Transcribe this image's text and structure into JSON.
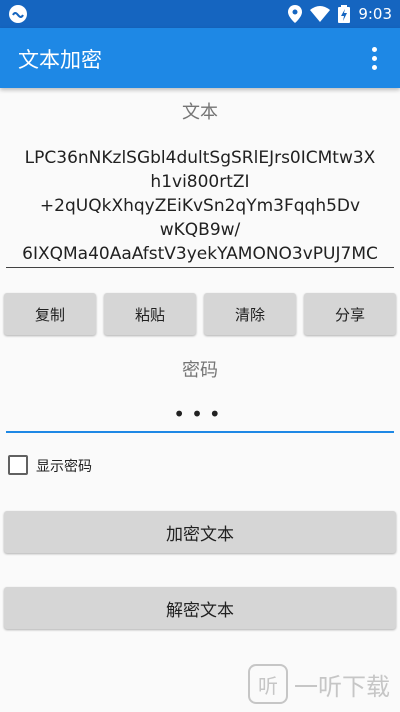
{
  "status_bar": {
    "time": "9:03",
    "app_icon": "link-icon",
    "icons": [
      "location-icon",
      "wifi-icon",
      "battery-charging-icon"
    ]
  },
  "app_bar": {
    "title": "文本加密",
    "menu_icon": "more-vert-icon"
  },
  "text_section": {
    "label": "文本",
    "value_lines": [
      "LPC36nNKzlSGbl4dultSgSRlEJrs0ICMtw3X",
      "h1vi800rtZI",
      "+2qUQkXhqyZEiKvSn2qYm3Fqqh5Dv",
      "wKQB9w/",
      "6IXQMa40AaAfstV3yekYAMONO3vPUJ7MC"
    ]
  },
  "actions": {
    "copy": "复制",
    "paste": "粘贴",
    "clear": "清除",
    "share": "分享"
  },
  "password_section": {
    "label": "密码",
    "masked_value": "•••",
    "show_password_label": "显示密码",
    "show_password_checked": false
  },
  "encrypt_button": "加密文本",
  "decrypt_button": "解密文本",
  "watermark": {
    "badge": "听",
    "text": "一听下载"
  },
  "colors": {
    "status_bar": "#1565c0",
    "app_bar": "#1e88e5",
    "accent": "#1e88e5",
    "button": "#d6d6d6"
  }
}
